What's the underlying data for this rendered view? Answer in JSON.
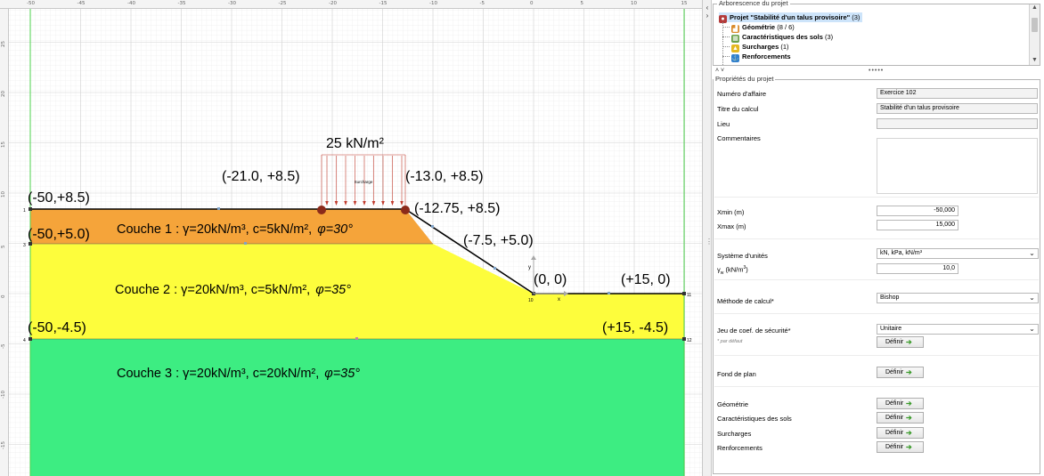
{
  "canvas": {
    "ruler_x_ticks": [
      "-50",
      "-45",
      "-40",
      "-35",
      "-30",
      "-25",
      "-20",
      "-15",
      "-10",
      "-5",
      "0",
      "5",
      "10",
      "15"
    ],
    "ruler_y_ticks": [
      "25",
      "20",
      "15",
      "10",
      "5",
      "0",
      "-5",
      "-10",
      "-15"
    ],
    "surcharge_value": "25 kN/m²",
    "surcharge_tag": "Surcharge",
    "coords": {
      "top_left": "(-50,+8.5)",
      "surch_left": "(-21.0, +8.5)",
      "surch_right": "(-13.0, +8.5)",
      "crest": "(-12.75, +8.5)",
      "left_mid": "(-50,+5.0)",
      "mid_slope": "(-7.5, +5.0)",
      "toe": "(0, 0)",
      "right_ground": "(+15, 0)",
      "left_bottom": "(-50,-4.5)",
      "right_bottom": "(+15, -4.5)"
    },
    "layers": {
      "couche1": "Couche 1 : γ=20kN/m³, c=5kN/m²,",
      "couche1_phi": "φ=30°",
      "couche2": "Couche 2 : γ=20kN/m³, c=5kN/m²,",
      "couche2_phi": "φ=35°",
      "couche3": "Couche 3 : γ=20kN/m³, c=20kN/m²,",
      "couche3_phi": "φ=35°"
    },
    "node_ids": {
      "n1": "1",
      "n3": "3",
      "n4": "4",
      "n10": "10",
      "n11": "11",
      "n12": "12"
    },
    "axis_letters": {
      "x": "x",
      "y": "y"
    },
    "colors": {
      "layer1": "#f5a43a",
      "layer2": "#fdfd3c",
      "layer3": "#3ded82",
      "surcharge": "#c0392b",
      "surcharge_pin": "#8b2a1a"
    }
  },
  "splitter": {
    "up": "‹",
    "down": "›",
    "grip": "⋮"
  },
  "tree": {
    "legend": "Arborescence du projet",
    "root": {
      "label": "Projet \"Stabilité d'un talus provisoire\"",
      "count": " (3)"
    },
    "items": [
      {
        "label": "Géométrie",
        "count": " (8 / 6)",
        "icon": "geometry-icon"
      },
      {
        "label": "Caractéristiques des sols",
        "count": " (3)",
        "icon": "soil-icon"
      },
      {
        "label": "Surcharges",
        "count": " (1)",
        "icon": "weight-icon"
      },
      {
        "label": "Renforcements",
        "count": "",
        "icon": "anchor-icon"
      }
    ],
    "collapse_arrows": "˄ ˅",
    "collapse_dots": "•••••"
  },
  "props": {
    "legend": "Propriétés du projet",
    "numero_label": "Numéro d'affaire",
    "numero_value": "Exercice 102",
    "titre_label": "Titre du calcul",
    "titre_value": "Stabilité d'un talus provisoire",
    "lieu_label": "Lieu",
    "lieu_value": "",
    "commentaires_label": "Commentaires",
    "xmin_label": "Xmin (m)",
    "xmin_value": "-50,000",
    "xmax_label": "Xmax (m)",
    "xmax_value": "15,000",
    "units_label": "Système d'unités",
    "units_value": "kN, kPa, kN/m³",
    "gamma_w_main": "γ",
    "gamma_w_sub": "w",
    "gamma_w_rest": " (kN/m",
    "gamma_w_sup": "3",
    "gamma_w_close": ")",
    "gamma_w_value": "10,0",
    "methode_label": "Méthode de calcul*",
    "methode_value": "Bishop",
    "jeu_label": "Jeu de coef. de sécurité*",
    "jeu_value": "Unitaire",
    "note": "* par défaut",
    "fond_label": "Fond de plan",
    "geometrie_label": "Géométrie",
    "caracteristiques_label": "Caractéristiques des sols",
    "surcharges_label": "Surcharges",
    "renforcements_label": "Renforcements",
    "definir": "Définir",
    "arrow_glyph": "➔",
    "dropdown_glyph": "⌄"
  }
}
